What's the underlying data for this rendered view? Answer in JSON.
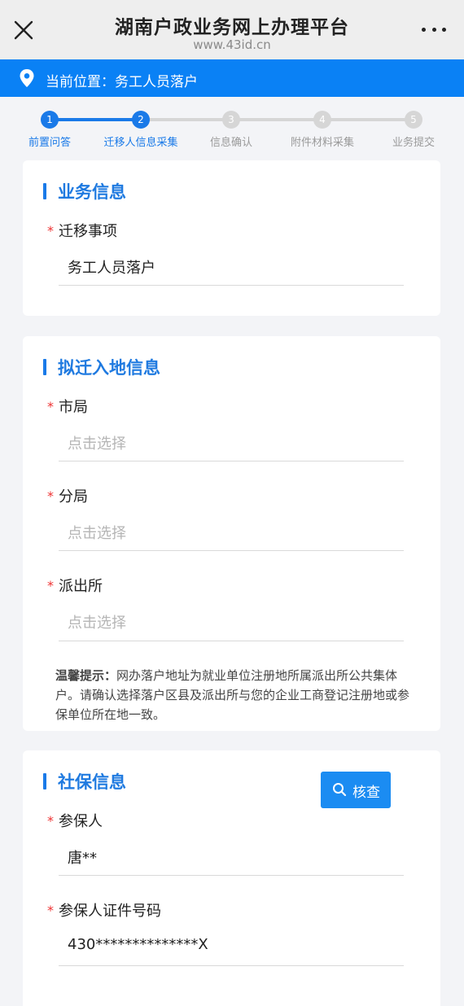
{
  "header": {
    "title": "湖南户政业务网上办理平台",
    "url": "www.43id.cn"
  },
  "location": {
    "text": "当前位置：务工人员落户"
  },
  "steps": [
    {
      "num": "1",
      "label": "前置问答",
      "state": "done"
    },
    {
      "num": "2",
      "label": "迁移人信息采集",
      "state": "active"
    },
    {
      "num": "3",
      "label": "信息确认",
      "state": "pending"
    },
    {
      "num": "4",
      "label": "附件材料采集",
      "state": "pending"
    },
    {
      "num": "5",
      "label": "业务提交",
      "state": "pending"
    }
  ],
  "business_info": {
    "title": "业务信息",
    "migration_item_label": "迁移事项",
    "migration_item_value": "务工人员落户"
  },
  "destination_info": {
    "title": "拟迁入地信息",
    "city_bureau_label": "市局",
    "city_bureau_placeholder": "点击选择",
    "branch_label": "分局",
    "branch_placeholder": "点击选择",
    "station_label": "派出所",
    "station_placeholder": "点击选择",
    "tip_title": "温馨提示：",
    "tip_text": "网办落户地址为就业单位注册地所属派出所公共集体户。请确认选择落户区县及派出所与您的企业工商登记注册地或参保单位所在地一致。"
  },
  "social_info": {
    "title": "社保信息",
    "check_button": "核查",
    "insured_label": "参保人",
    "insured_value": "唐**",
    "id_label": "参保人证件号码",
    "id_value": "430**************X"
  },
  "colors": {
    "primary": "#0a81f5",
    "active_step": "#1a7ae8",
    "pending_step": "#d6d6d6",
    "required": "#e33333"
  }
}
